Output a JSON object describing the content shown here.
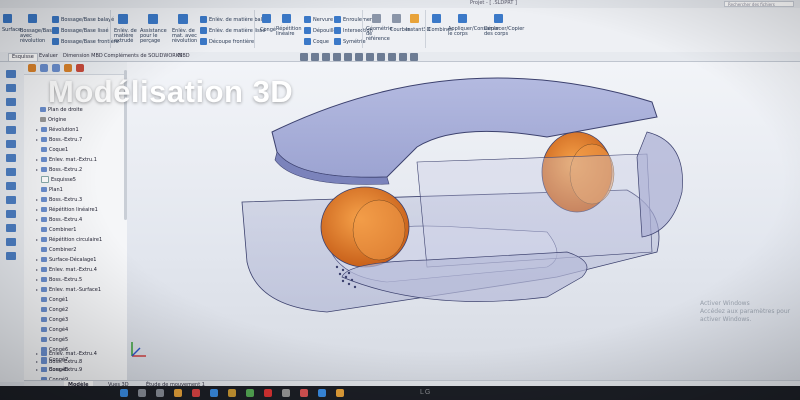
{
  "window": {
    "title": "Projet - [ .SLDPRT ]",
    "search_placeholder": "Rechercher des fichiers"
  },
  "ribbon": {
    "items": [
      "Bossage/Base balayé",
      "Bossage/Base lissé",
      "Bossage/Base frontière",
      "Enlèv. de matière extrudé",
      "Assistance pour le perçage",
      "Enlèv. de mat. avec révolution",
      "Enlèv. de matière balayé",
      "Enlèv. de matière lissé",
      "Découpe frontière",
      "Congé",
      "Répétition linéaire",
      "Nervure",
      "Dépouille",
      "Coque",
      "Enroulement",
      "Intersection",
      "Symétrie",
      "Géométrie de référence",
      "Courbes",
      "Instant3D",
      "Combiner",
      "Appliquer/Consumer le corps",
      "Déplacer/Copier des corps"
    ],
    "left_labels": [
      "Surface",
      "Bossage/Base avec révolution"
    ]
  },
  "command_tabs": [
    "Esquisse",
    "Evaluer",
    "Dimension MBD",
    "Compléments de SOLIDWORKS",
    "MBD"
  ],
  "overlay": {
    "title": "Modélisation 3D"
  },
  "feature_tree": {
    "items": [
      "Plan de droite",
      "Origine",
      "Révolution1",
      "Boss.-Extru.7",
      "Coque1",
      "Enlev. mat.-Extru.1",
      "Boss.-Extru.2",
      "Esquisse5",
      "Plan1",
      "Boss.-Extru.3",
      "Répétition linéaire1",
      "Boss.-Extru.4",
      "Combiner1",
      "Répétition circulaire1",
      "Combiner2",
      "Surface-Décalage1",
      "Enlev. mat.-Extru.4",
      "Boss.-Extru.5",
      "Enlev. mat.-Surface1",
      "Congé1",
      "Congé2",
      "Congé3",
      "Congé4",
      "Congé5",
      "Congé6",
      "Congé7",
      "Congé8",
      "Congé9",
      "Enlev. mat.-Extru.4",
      "Boss.-Extru.8",
      "Boss.-Extru.9"
    ]
  },
  "bottom_tabs": [
    "Modèle",
    "Vues 3D",
    "Étude de mouvement 1"
  ],
  "viewport": {
    "model_colors": {
      "body": "#8a93c9",
      "magnet": "#e8802a",
      "edge": "#3c416e"
    },
    "watermark": [
      "Activer Windows",
      "Accédez aux paramètres pour activer Windows."
    ]
  },
  "monitor": {
    "brand": "LG"
  }
}
